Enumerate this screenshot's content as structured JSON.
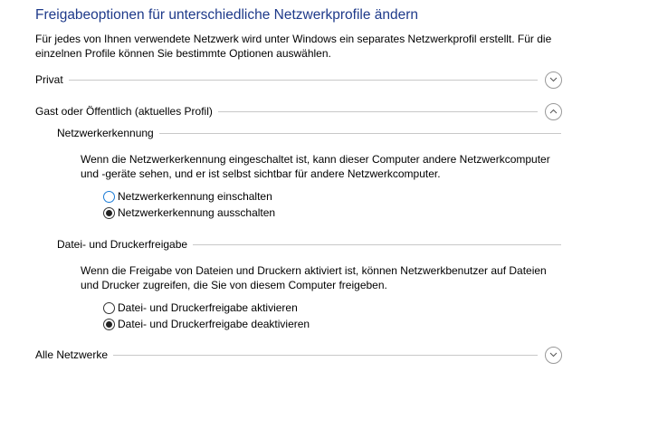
{
  "title": "Freigabeoptionen für unterschiedliche Netzwerkprofile ändern",
  "description": "Für jedes von Ihnen verwendete Netzwerk wird unter Windows ein separates Netzwerkprofil erstellt. Für die einzelnen Profile können Sie bestimmte Optionen auswählen.",
  "profiles": {
    "private": {
      "label": "Privat",
      "expanded": false
    },
    "public": {
      "label": "Gast oder Öffentlich (aktuelles Profil)",
      "expanded": true
    },
    "all": {
      "label": "Alle Netzwerke",
      "expanded": false
    }
  },
  "discovery": {
    "heading": "Netzwerkerkennung",
    "text": "Wenn die Netzwerkerkennung eingeschaltet ist, kann dieser Computer andere Netzwerkcomputer und -geräte sehen, und er ist selbst sichtbar für andere Netzwerkcomputer.",
    "options": [
      "Netzwerkerkennung einschalten",
      "Netzwerkerkennung ausschalten"
    ],
    "selected": 1
  },
  "sharing": {
    "heading": "Datei- und Druckerfreigabe",
    "text": "Wenn die Freigabe von Dateien und Druckern aktiviert ist, können Netzwerkbenutzer auf Dateien und Drucker zugreifen, die Sie von diesem Computer freigeben.",
    "options": [
      "Datei- und Druckerfreigabe aktivieren",
      "Datei- und Druckerfreigabe deaktivieren"
    ],
    "selected": 1
  }
}
